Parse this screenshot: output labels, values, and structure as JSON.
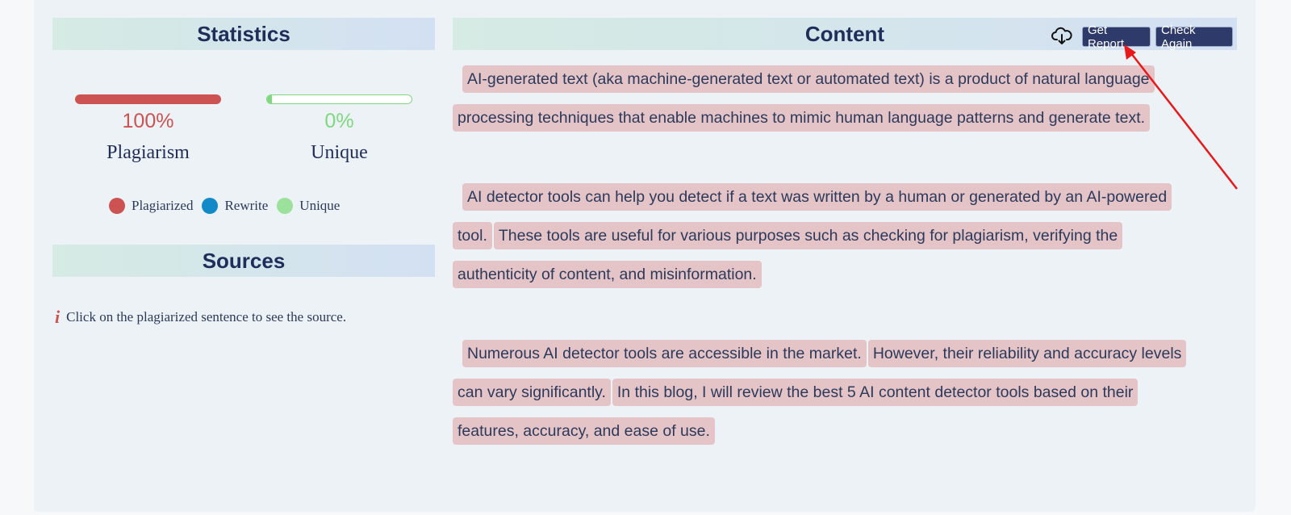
{
  "statistics": {
    "title": "Statistics",
    "plagiarism": {
      "percent_text": "100%",
      "label": "Plagiarism",
      "value": 1.0,
      "color": "#cd5252"
    },
    "unique": {
      "percent_text": "0%",
      "label": "Unique",
      "value": 0.0,
      "color": "#7ed87e"
    },
    "legend": [
      {
        "label": "Plagiarized",
        "color": "#cd5252"
      },
      {
        "label": "Rewrite",
        "color": "#128ac8"
      },
      {
        "label": "Unique",
        "color": "#9be09b"
      }
    ]
  },
  "sources": {
    "title": "Sources",
    "info_icon": "info-icon",
    "info_text": "Click on the plagiarized sentence to see the source."
  },
  "content": {
    "title": "Content",
    "download_icon": "cloud-download-icon",
    "get_report_label": "Get Report",
    "check_again_label": "Check Again",
    "paragraphs": [
      {
        "lines": [
          [
            "AI-generated text (aka machine-generated text or automated text) is a product of natural language"
          ],
          [
            "processing techniques that enable machines to mimic human language patterns and generate text."
          ]
        ]
      },
      {
        "lines": [
          [
            "AI detector tools can help you detect if a text was written by a human or generated by an AI-powered"
          ],
          [
            "tool.",
            "These tools are useful for various purposes such as checking for plagiarism, verifying the"
          ],
          [
            "authenticity of content, and misinformation."
          ]
        ]
      },
      {
        "lines": [
          [
            "Numerous AI detector tools are accessible in the market.",
            "However, their reliability and accuracy levels"
          ],
          [
            "can vary significantly.",
            "In this blog, I will review the best 5 AI content detector tools based on their"
          ],
          [
            "features, accuracy, and ease of use."
          ]
        ]
      }
    ]
  },
  "annotation": {
    "arrow_color": "#e8191b"
  }
}
